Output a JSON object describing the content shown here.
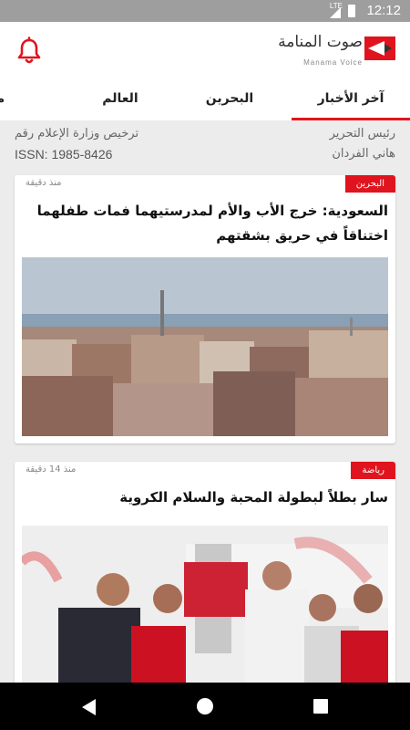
{
  "status_bar": {
    "time": "12:12",
    "network": "LTE"
  },
  "app": {
    "logo_text": "صوت المنامة",
    "logo_subtext": "Manama Voice",
    "colors": {
      "accent": "#e0141e",
      "background": "#ececec"
    }
  },
  "tabs": [
    {
      "label": "آخر الأخبار",
      "active": true
    },
    {
      "label": "البحرين",
      "active": false
    },
    {
      "label": "العالم",
      "active": false
    },
    {
      "label": "منو",
      "active": false
    }
  ],
  "info": {
    "editor_title": "رئيس التحرير",
    "editor_name": "هاني الفردان",
    "license_label": "ترخيص وزارة الإعلام رقم",
    "issn": "ISSN: 1985-8426"
  },
  "articles": [
    {
      "category": "البحرين",
      "time": "منذ دقيقة",
      "headline": "السعودية: خرج الأب والأم لمدرستيهما فمات طفلهما اختناقاً في حريق بشقتهم"
    },
    {
      "category": "رياضة",
      "time": "منذ 14 دقيقة",
      "headline": "سار بطلاً لبطولة المحبة والسلام الكروية"
    }
  ],
  "icons": {
    "bell": "bell-icon",
    "back": "back-icon",
    "home": "home-icon",
    "recent": "recent-apps-icon"
  }
}
